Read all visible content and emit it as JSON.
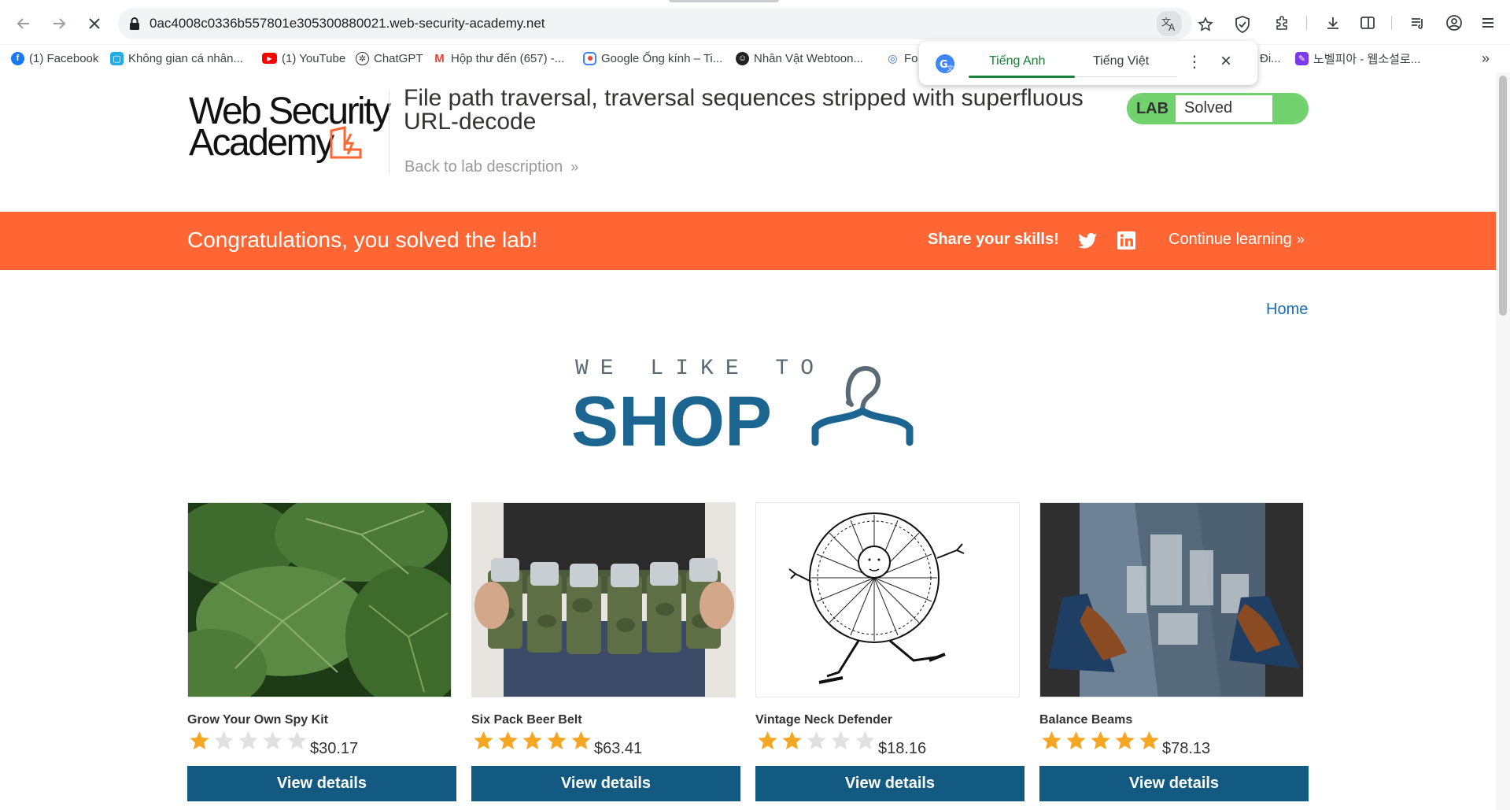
{
  "browser": {
    "url": "0ac4008c0336b557801e305300880021.web-security-academy.net",
    "bookmarks": [
      {
        "label": "(1) Facebook",
        "icon": "facebook-icon",
        "color": "#1877f2"
      },
      {
        "label": "Không gian cá nhân...",
        "icon": "bilibili-icon",
        "color": "#23ade5"
      },
      {
        "label": "(1) YouTube",
        "icon": "youtube-icon",
        "color": "#ff0000"
      },
      {
        "label": "ChatGPT",
        "icon": "chatgpt-icon",
        "color": "#333333"
      },
      {
        "label": "Hộp thư đến (657) -...",
        "icon": "gmail-icon",
        "color": "#ea4335"
      },
      {
        "label": "Google Ống kính – Ti...",
        "icon": "google-lens-icon",
        "color": "#4285f4"
      },
      {
        "label": "Nhân Vật Webtoon...",
        "icon": "webtoon-icon",
        "color": "#222222"
      },
      {
        "label": "Fo",
        "icon": "fo-icon",
        "color": "#3b6fd8"
      },
      {
        "label": "Đi...",
        "icon": "",
        "color": ""
      },
      {
        "label": "노벨피아 - 웹소설로...",
        "icon": "novelpia-icon",
        "color": "#7c3aed"
      }
    ],
    "translate_popup": {
      "tab_source": "Tiếng Anh",
      "tab_target": "Tiếng Việt"
    }
  },
  "header": {
    "logo_line1": "Web Security",
    "logo_line2": "Academy",
    "lab_title": "File path traversal, traversal sequences stripped with superfluous URL-decode",
    "back_link": "Back to lab description",
    "chevrons": "»",
    "lab_badge": "LAB",
    "lab_status": "Solved"
  },
  "banner": {
    "congrats": "Congratulations, you solved the lab!",
    "share": "Share your skills!",
    "continue": "Continue learning",
    "chevrons": "»"
  },
  "nav": {
    "home": "Home"
  },
  "shop": {
    "tagline": "WE LIKE TO",
    "word": "SHOP"
  },
  "products": [
    {
      "name": "Grow Your Own Spy Kit",
      "rating": 1,
      "price": "$30.17",
      "button": "View details"
    },
    {
      "name": "Six Pack Beer Belt",
      "rating": 5,
      "price": "$63.41",
      "button": "View details"
    },
    {
      "name": "Vintage Neck Defender",
      "rating": 2,
      "price": "$18.16",
      "button": "View details"
    },
    {
      "name": "Balance Beams",
      "rating": 5,
      "price": "$78.13",
      "button": "View details"
    }
  ],
  "colors": {
    "banner": "#ff6633",
    "button": "#135a82",
    "solved_green": "#70d16d",
    "star_filled": "#f5a623",
    "star_empty": "#e0e0e0",
    "shop_blue": "#1c6591"
  }
}
